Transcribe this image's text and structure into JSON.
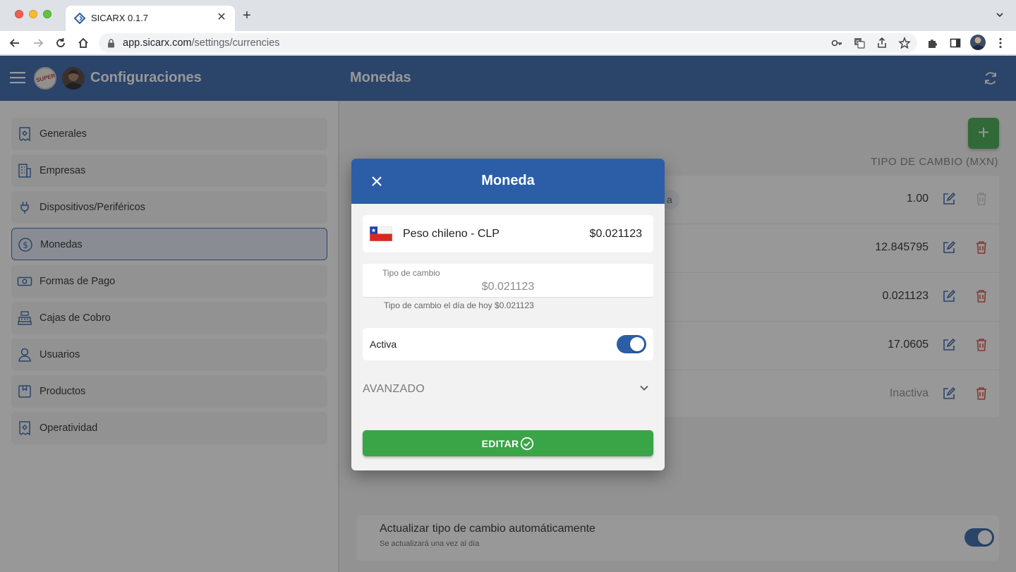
{
  "browser": {
    "tab_title": "SICARX 0.1.7",
    "url_host": "app.sicarx.com",
    "url_path": "/settings/currencies"
  },
  "header": {
    "title": "Configuraciones",
    "section_title": "Monedas",
    "logo_text": "SUPER"
  },
  "sidebar": {
    "items": [
      {
        "label": "Generales",
        "icon": "receipt-settings-icon"
      },
      {
        "label": "Empresas",
        "icon": "building-icon"
      },
      {
        "label": "Dispositivos/Periféricos",
        "icon": "plug-icon"
      },
      {
        "label": "Monedas",
        "icon": "dollar-circle-icon",
        "active": true
      },
      {
        "label": "Formas de Pago",
        "icon": "banknote-icon"
      },
      {
        "label": "Cajas de Cobro",
        "icon": "cash-register-icon"
      },
      {
        "label": "Usuarios",
        "icon": "user-icon"
      },
      {
        "label": "Productos",
        "icon": "box-icon"
      },
      {
        "label": "Operatividad",
        "icon": "receipt-settings-icon"
      }
    ]
  },
  "main": {
    "add_label": "+",
    "column_header": "TIPO DE CAMBIO (MXN)",
    "rows": [
      {
        "value": "1.00",
        "chip": "a",
        "deletable": false
      },
      {
        "value": "12.845795",
        "deletable": true
      },
      {
        "value": "0.021123",
        "deletable": true
      },
      {
        "value": "17.0605",
        "deletable": true
      },
      {
        "value": "Inactiva",
        "inactive": true,
        "deletable": true
      }
    ],
    "auto_update": {
      "title": "Actualizar tipo de cambio automáticamente",
      "subtitle": "Se actualizará una vez al día",
      "enabled": true
    }
  },
  "modal": {
    "title": "Moneda",
    "currency_name": "Peso chileno - CLP",
    "currency_rate": "$0.021123",
    "rate_field_label": "Tipo de cambio",
    "rate_field_value": "$0.021123",
    "rate_hint": "Tipo de cambio el día de hoy $0.021123",
    "active_label": "Activa",
    "active_enabled": true,
    "advanced_label": "AVANZADO",
    "submit_label": "EDITAR"
  },
  "colors": {
    "primary": "#2c5ea8",
    "success": "#3aa547",
    "danger": "#d9453d"
  }
}
